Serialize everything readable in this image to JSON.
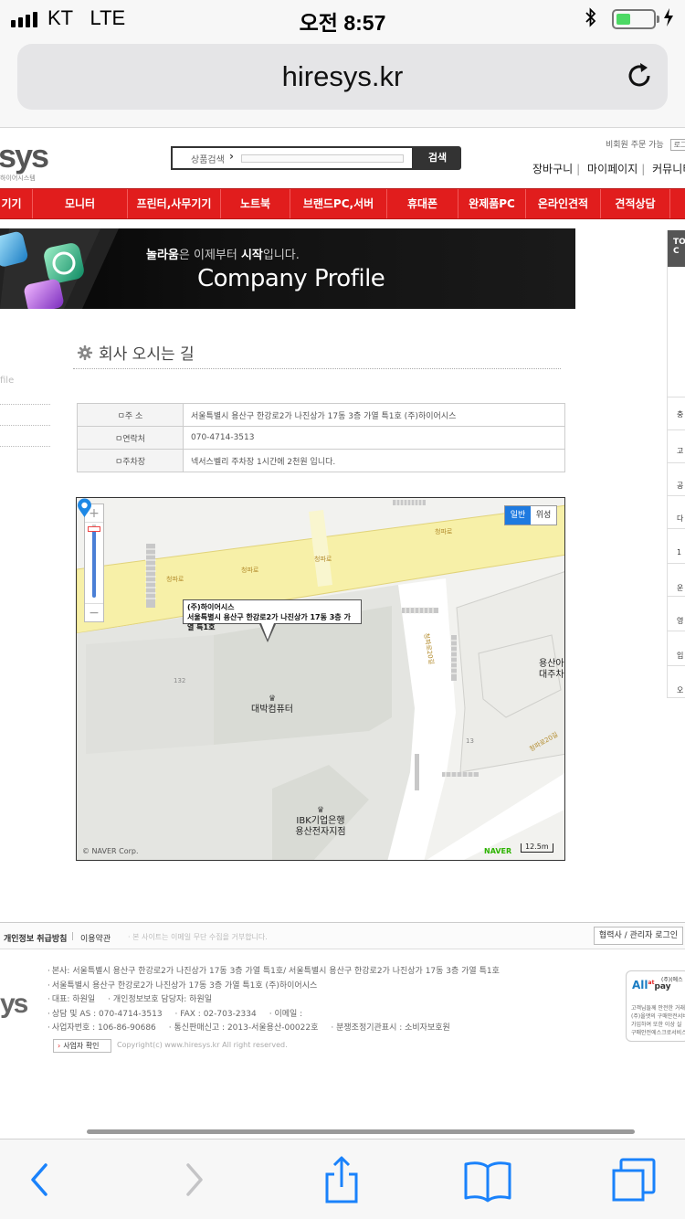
{
  "status_bar": {
    "carrier": "KT",
    "network": "LTE",
    "time": "오전 8:57"
  },
  "browser": {
    "url": "hiresys.kr"
  },
  "header": {
    "logo": "sys",
    "logo_sub": "하이어시스템",
    "search_label": "상품검색",
    "search_button": "검색",
    "guest_order": "비회원 주문 가능",
    "login": "로그",
    "links": [
      "장바구니",
      "마이페이지",
      "커뮤니티"
    ]
  },
  "nav": {
    "items": [
      "기기",
      "모니터",
      "프린터,사무기기",
      "노트북",
      "브랜드PC,서버",
      "휴대폰",
      "완제품PC",
      "온라인견적",
      "견적상담"
    ]
  },
  "banner": {
    "tag_1": "놀라움",
    "tag_2": "은 이제부터 ",
    "tag_3": "시작",
    "tag_4": "입니다.",
    "title": "Company Profile"
  },
  "rightbar": {
    "header": "TO C",
    "items": [
      "충",
      "고",
      "공",
      "다",
      "1",
      "운",
      "영",
      "입",
      "오"
    ]
  },
  "leftside": {
    "text": "file"
  },
  "content": {
    "title": "회사 오시는 길",
    "rows": [
      {
        "label": "ㅁ주    소",
        "value": "서울특별시 용산구 한강로2가 나진상가 17동 3층 가열 특1호 (주)하이어시스"
      },
      {
        "label": "ㅁ연락처",
        "value": "070-4714-3513"
      },
      {
        "label": "ㅁ주차장",
        "value": "넥서스벨리 주차장 1시간에 2천원 입니다."
      }
    ]
  },
  "map": {
    "tabs": [
      "일반",
      "위성"
    ],
    "callout_line1": "(주)하이어시스",
    "callout_line2": "서울특별시 용산구 한강로2가 나진상가 17동 3층 가열 특1호",
    "poi_computer": "대박컴퓨터",
    "poi_bank_1": "IBK기업은행",
    "poi_bank_2": "용산전자지점",
    "poi_right_1": "용산아",
    "poi_right_2": "대주차",
    "road_1": "청파로",
    "road_2": "청파로",
    "road_3": "청파로",
    "road_4": "청파로",
    "road_5": "청파로20길",
    "road_6": "청파로20길",
    "num_132": "132",
    "num_13": "13",
    "copyright": "© NAVER Corp.",
    "naver": "NAVER",
    "scale": "12.5m",
    "zoom_in": "+",
    "zoom_out": "−"
  },
  "footer": {
    "privacy": "개인정보 취급방침",
    "terms": "이용약관",
    "notice": "· 본 사이트는 이메일 무단 수집을 거부합니다.",
    "admin_login": "협력사 / 관리자 로그인",
    "logo": "ys",
    "line1": "본사: 서울특별시 용산구 한강로2가 나진상가 17동 3층 가열 특1호/ 서울특별시 용산구 한강로2가 나진상가 17동 3층 가열 특1호",
    "line2": "서울특별시 용산구 한강로2가 나진상가 17동 3층 가열 특1호 (주)하이어시스",
    "line3a": "대표: 하원일",
    "line3b": "· 개인정보보호 담당자: 하원일",
    "line4a": "상담 및 AS : 070-4714-3513",
    "line4b": "· FAX : 02-703-2334",
    "line4c": "· 이메일 :",
    "line5a": "사업자번호 : 106-86-90686",
    "line5b": "· 통신판매신고 : 2013-서울용산-00022호",
    "line5c": "· 분쟁조정기관표시 : 소비자보호원",
    "biz_check": "사업자 확인",
    "copyright": "Copyright(c) www.hiresys.kr All right reserved.",
    "allpay_brand": "All",
    "allpay_pay": "pay",
    "allpay_sub": "(주)(에스",
    "allpay_desc": "고객님들께 안전한 거래\n(주)올앳의 구매안전서비\n가입하여 또한 이상 실\n구매안전에스크로서비스"
  }
}
